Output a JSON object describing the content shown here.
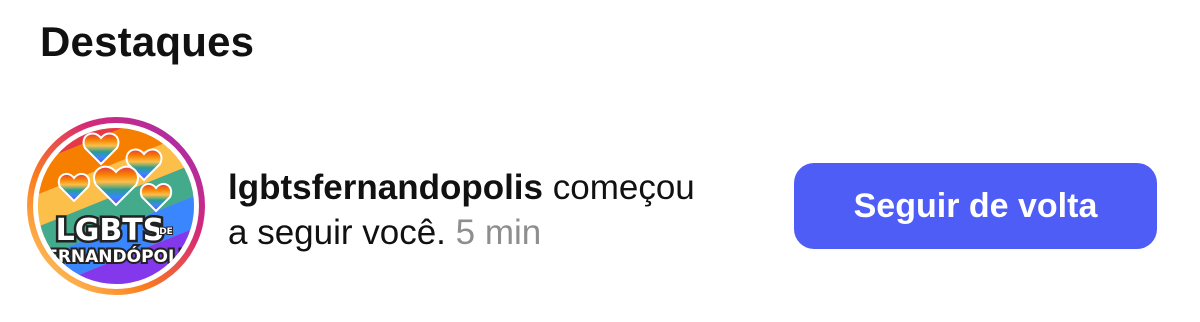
{
  "section": {
    "title": "Destaques"
  },
  "notification": {
    "username": "lgbtsfernandopolis",
    "action_part1": "começou",
    "action_part2": "a seguir você.",
    "time": "5 min",
    "avatar_logo_text": "LGBTS DE FERNANDÓPOLIS",
    "follow_back_label": "Seguir de volta"
  },
  "colors": {
    "accent": "#4f5df7",
    "muted_text": "#8e8e8e"
  }
}
